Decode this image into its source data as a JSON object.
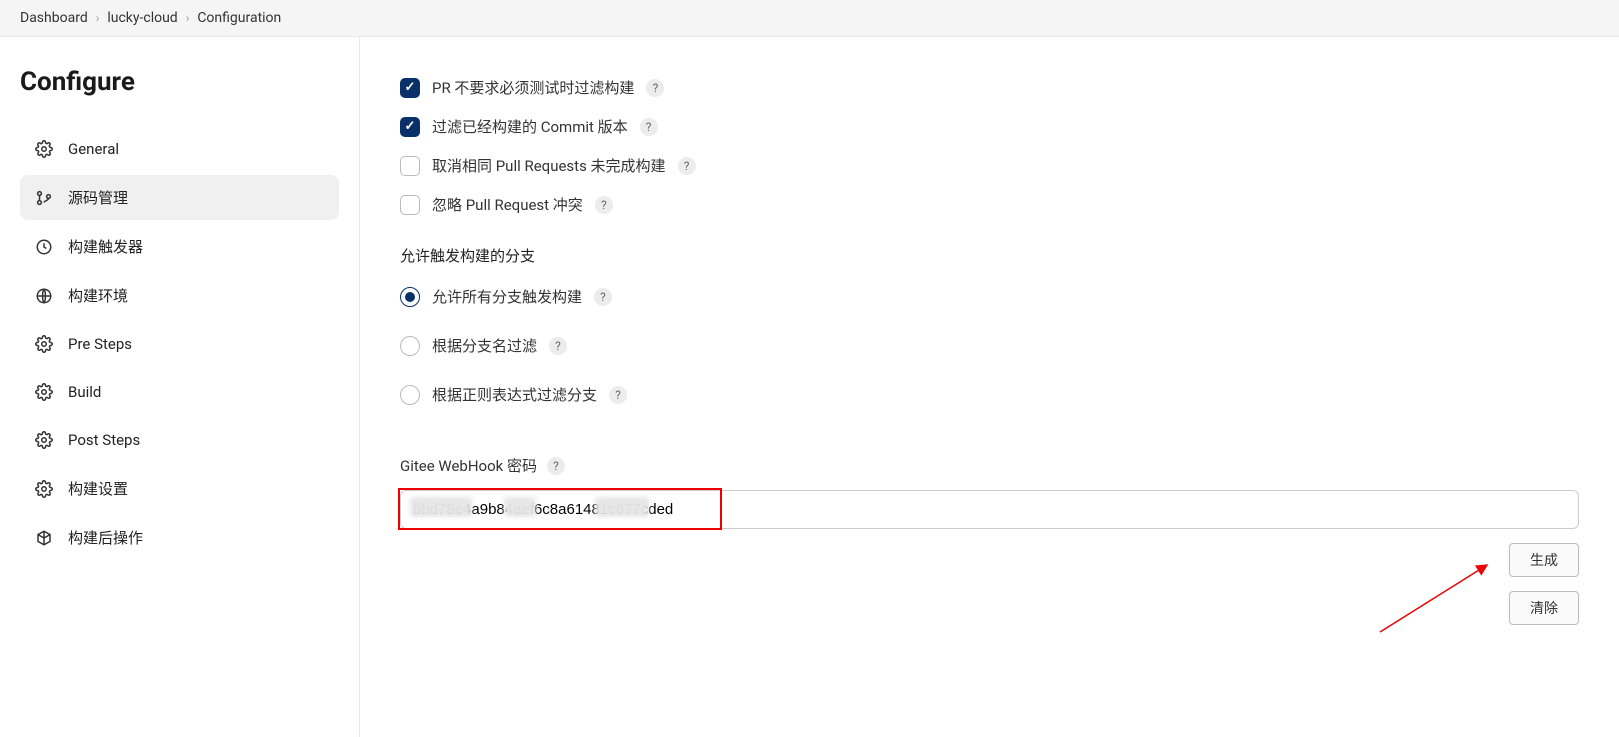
{
  "breadcrumb": {
    "items": [
      "Dashboard",
      "lucky-cloud",
      "Configuration"
    ]
  },
  "sidebar": {
    "title": "Configure",
    "items": [
      {
        "label": "General"
      },
      {
        "label": "源码管理"
      },
      {
        "label": "构建触发器"
      },
      {
        "label": "构建环境"
      },
      {
        "label": "Pre Steps"
      },
      {
        "label": "Build"
      },
      {
        "label": "Post Steps"
      },
      {
        "label": "构建设置"
      },
      {
        "label": "构建后操作"
      }
    ]
  },
  "main": {
    "checkboxes": [
      {
        "label": "PR 不要求必须测试时过滤构建",
        "checked": true
      },
      {
        "label": "过滤已经构建的 Commit 版本",
        "checked": true
      },
      {
        "label": "取消相同 Pull Requests 未完成构建",
        "checked": false
      },
      {
        "label": "忽略 Pull Request 冲突",
        "checked": false
      }
    ],
    "branch_section_label": "允许触发构建的分支",
    "radios": [
      {
        "label": "允许所有分支触发构建",
        "checked": true
      },
      {
        "label": "根据分支名过滤",
        "checked": false
      },
      {
        "label": "根据正则表达式过滤分支",
        "checked": false
      }
    ],
    "webhook_label": "Gitee WebHook 密码",
    "webhook_value": "bbd78e4a9b84aef6c8a61481c677cded",
    "generate_btn": "生成",
    "clear_btn": "清除",
    "help_symbol": "?"
  }
}
